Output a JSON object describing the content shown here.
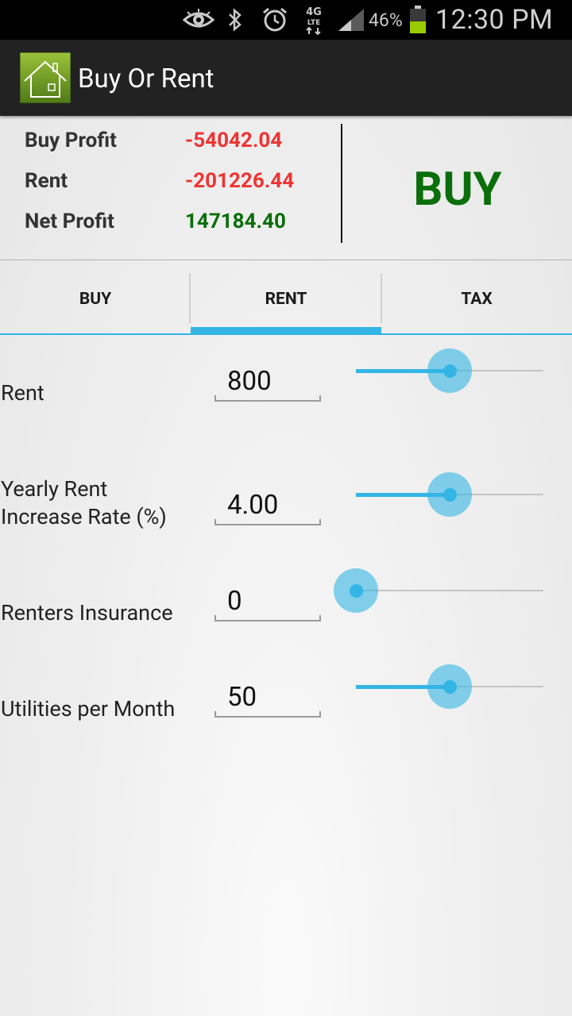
{
  "status_bar": {
    "icons": [
      "eye-icon",
      "bluetooth-icon",
      "alarm-icon",
      "lte-icon",
      "signal-icon",
      "battery-icon"
    ],
    "lte_top": "4G",
    "lte_bottom": "LTE",
    "battery_percent": "46%",
    "time": "12:30 PM"
  },
  "app": {
    "title": "Buy Or Rent",
    "logo_icon": "house-icon"
  },
  "summary": {
    "buy_profit_label": "Buy Profit",
    "buy_profit_value": "-54042.04",
    "rent_label": "Rent",
    "rent_value": "-201226.44",
    "net_profit_label": "Net Profit",
    "net_profit_value": "147184.40",
    "verdict": "BUY"
  },
  "tabs": [
    {
      "label": "BUY",
      "selected": false
    },
    {
      "label": "RENT",
      "selected": true
    },
    {
      "label": "TAX",
      "selected": false
    }
  ],
  "rows": [
    {
      "label": "Rent",
      "value": "800",
      "slider_fraction": 0.5
    },
    {
      "label": "Yearly Rent\nIncrease Rate (%)",
      "value": "4.00",
      "slider_fraction": 0.5
    },
    {
      "label": "Renters Insurance",
      "value": "0",
      "slider_fraction": 0.0
    },
    {
      "label": "Utilities per Month",
      "value": "50",
      "slider_fraction": 0.5
    }
  ],
  "colors": {
    "accent": "#33b5e5",
    "negative": "#ee3333",
    "positive": "#0a6e0a",
    "action_bar": "#222222"
  }
}
